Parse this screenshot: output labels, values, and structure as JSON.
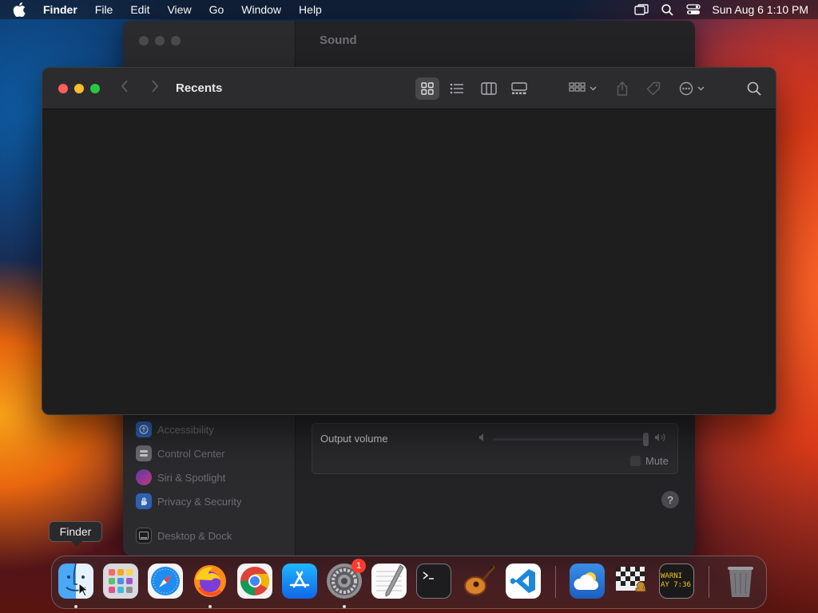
{
  "menubar": {
    "app_name": "Finder",
    "items": [
      "File",
      "Edit",
      "View",
      "Go",
      "Window",
      "Help"
    ],
    "clock": "Sun Aug 6  1:10 PM"
  },
  "settings": {
    "title": "Sound",
    "sidebar": [
      {
        "label": "Accessibility",
        "color": "#2f7cf6"
      },
      {
        "label": "Control Center",
        "color": "#8e8e93"
      },
      {
        "label": "Siri & Spotlight",
        "color": "#c45cf5"
      },
      {
        "label": "Privacy & Security",
        "color": "#3b82f6"
      },
      {
        "label": "Desktop & Dock",
        "color": "#1c1c1e"
      }
    ],
    "output_volume_label": "Output volume",
    "mute_label": "Mute",
    "help_label": "?"
  },
  "finder": {
    "title": "Recents"
  },
  "tooltip": "Finder",
  "dock": {
    "apps": [
      "Finder",
      "Launchpad",
      "Safari",
      "Firefox",
      "Chrome",
      "App Store",
      "System Settings",
      "TextEdit",
      "Terminal",
      "GarageBand",
      "VS Code",
      "Weather",
      "Chess",
      "Console",
      "Trash"
    ],
    "settings_badge": "1",
    "console_text": "WARNI\nAY 7:36"
  }
}
